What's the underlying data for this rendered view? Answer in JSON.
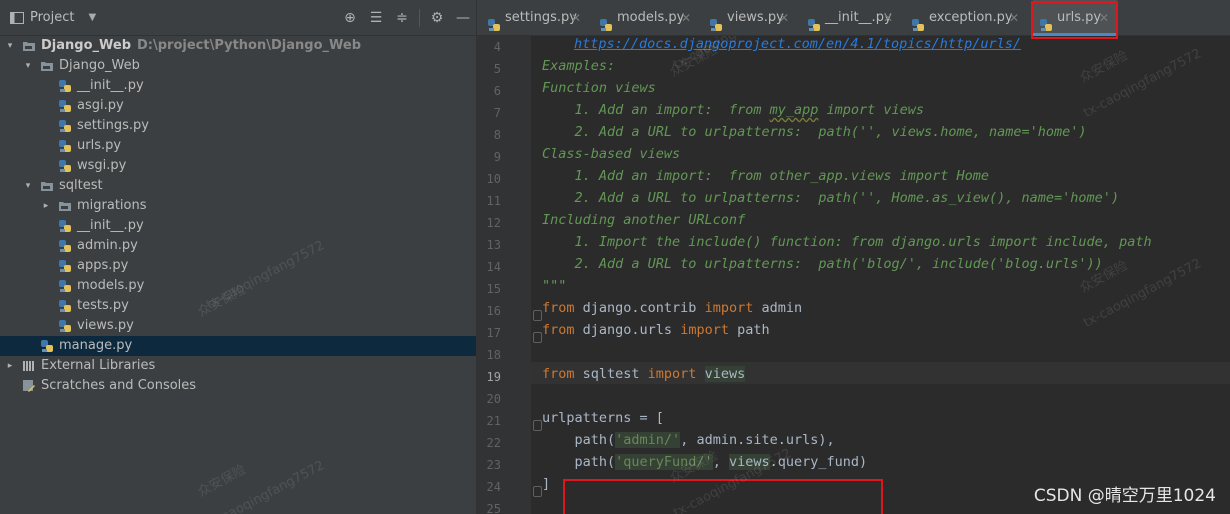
{
  "sidebar": {
    "title": "Project",
    "tree": [
      {
        "label": "Django_Web",
        "path": "D:\\project\\Python\\Django_Web",
        "kind": "folder",
        "expanded": true
      },
      {
        "label": "Django_Web",
        "kind": "folder",
        "expanded": true
      },
      {
        "label": "__init__.py",
        "kind": "python-file"
      },
      {
        "label": "asgi.py",
        "kind": "python-file"
      },
      {
        "label": "settings.py",
        "kind": "python-file"
      },
      {
        "label": "urls.py",
        "kind": "python-file"
      },
      {
        "label": "wsgi.py",
        "kind": "python-file"
      },
      {
        "label": "sqltest",
        "kind": "folder",
        "expanded": true
      },
      {
        "label": "migrations",
        "kind": "folder",
        "expanded": false
      },
      {
        "label": "__init__.py",
        "kind": "python-file"
      },
      {
        "label": "admin.py",
        "kind": "python-file"
      },
      {
        "label": "apps.py",
        "kind": "python-file"
      },
      {
        "label": "models.py",
        "kind": "python-file"
      },
      {
        "label": "tests.py",
        "kind": "python-file"
      },
      {
        "label": "views.py",
        "kind": "python-file"
      },
      {
        "label": "manage.py",
        "kind": "python-file",
        "selected": true
      },
      {
        "label": "External Libraries",
        "kind": "library",
        "expanded": false
      },
      {
        "label": "Scratches and Consoles",
        "kind": "scratches"
      }
    ]
  },
  "tabs": [
    {
      "label": "settings.py",
      "active": false
    },
    {
      "label": "models.py",
      "active": false
    },
    {
      "label": "views.py",
      "active": false
    },
    {
      "label": "__init__.py",
      "active": false
    },
    {
      "label": "exception.py",
      "active": false
    },
    {
      "label": "urls.py",
      "active": true
    }
  ],
  "editor": {
    "current_line": 19,
    "line_numbers": [
      "4",
      "5",
      "6",
      "7",
      "8",
      "9",
      "10",
      "11",
      "12",
      "13",
      "14",
      "15",
      "16",
      "17",
      "18",
      "19",
      "20",
      "21",
      "22",
      "23",
      "24",
      "25"
    ],
    "lines": {
      "l4": "https://docs.djangoproject.com/en/4.1/topics/http/urls/",
      "l5": "Examples:",
      "l6": "Function views",
      "l7a": "    1. Add an import:  from ",
      "l7b": "my_app",
      "l7c": " import views",
      "l8": "    2. Add a URL to urlpatterns:  path('', views.home, name='home')",
      "l9": "Class-based views",
      "l10": "    1. Add an import:  from other_app.views import Home",
      "l11": "    2. Add a URL to urlpatterns:  path('', Home.as_view(), name='home')",
      "l12": "Including another URLconf",
      "l13": "    1. Import the include() function: from django.urls import include, path",
      "l14": "    2. Add a URL to urlpatterns:  path('blog/', include('blog.urls'))",
      "l15": "\"\"\"",
      "l16a": "from",
      "l16b": " django.contrib ",
      "l16c": "import",
      "l16d": " admin",
      "l17a": "from",
      "l17b": " django.urls ",
      "l17c": "import",
      "l17d": " path",
      "l19a": "from",
      "l19b": " sqltest ",
      "l19c": "import",
      "l19d": "views",
      "l21": "urlpatterns = [",
      "l22a": "    path(",
      "l22b": "'admin/'",
      "l22c": ", admin.site.urls),",
      "l23a": "    path(",
      "l23b": "'queryFund/'",
      "l23c": ", ",
      "l23d": "views",
      "l23e": ".query_fund)",
      "l24": "]"
    }
  },
  "watermarks": {
    "cn": "众安保险",
    "id": "tx-caoqingfang7572"
  },
  "csdn": "CSDN @晴空万里1024",
  "colors": {
    "sidebar_bg": "#3c3f41",
    "editor_bg": "#2b2b2b",
    "docstring": "#629755",
    "keyword": "#cc7832",
    "string": "#6a8759",
    "highlight_border": "#e0161e"
  }
}
